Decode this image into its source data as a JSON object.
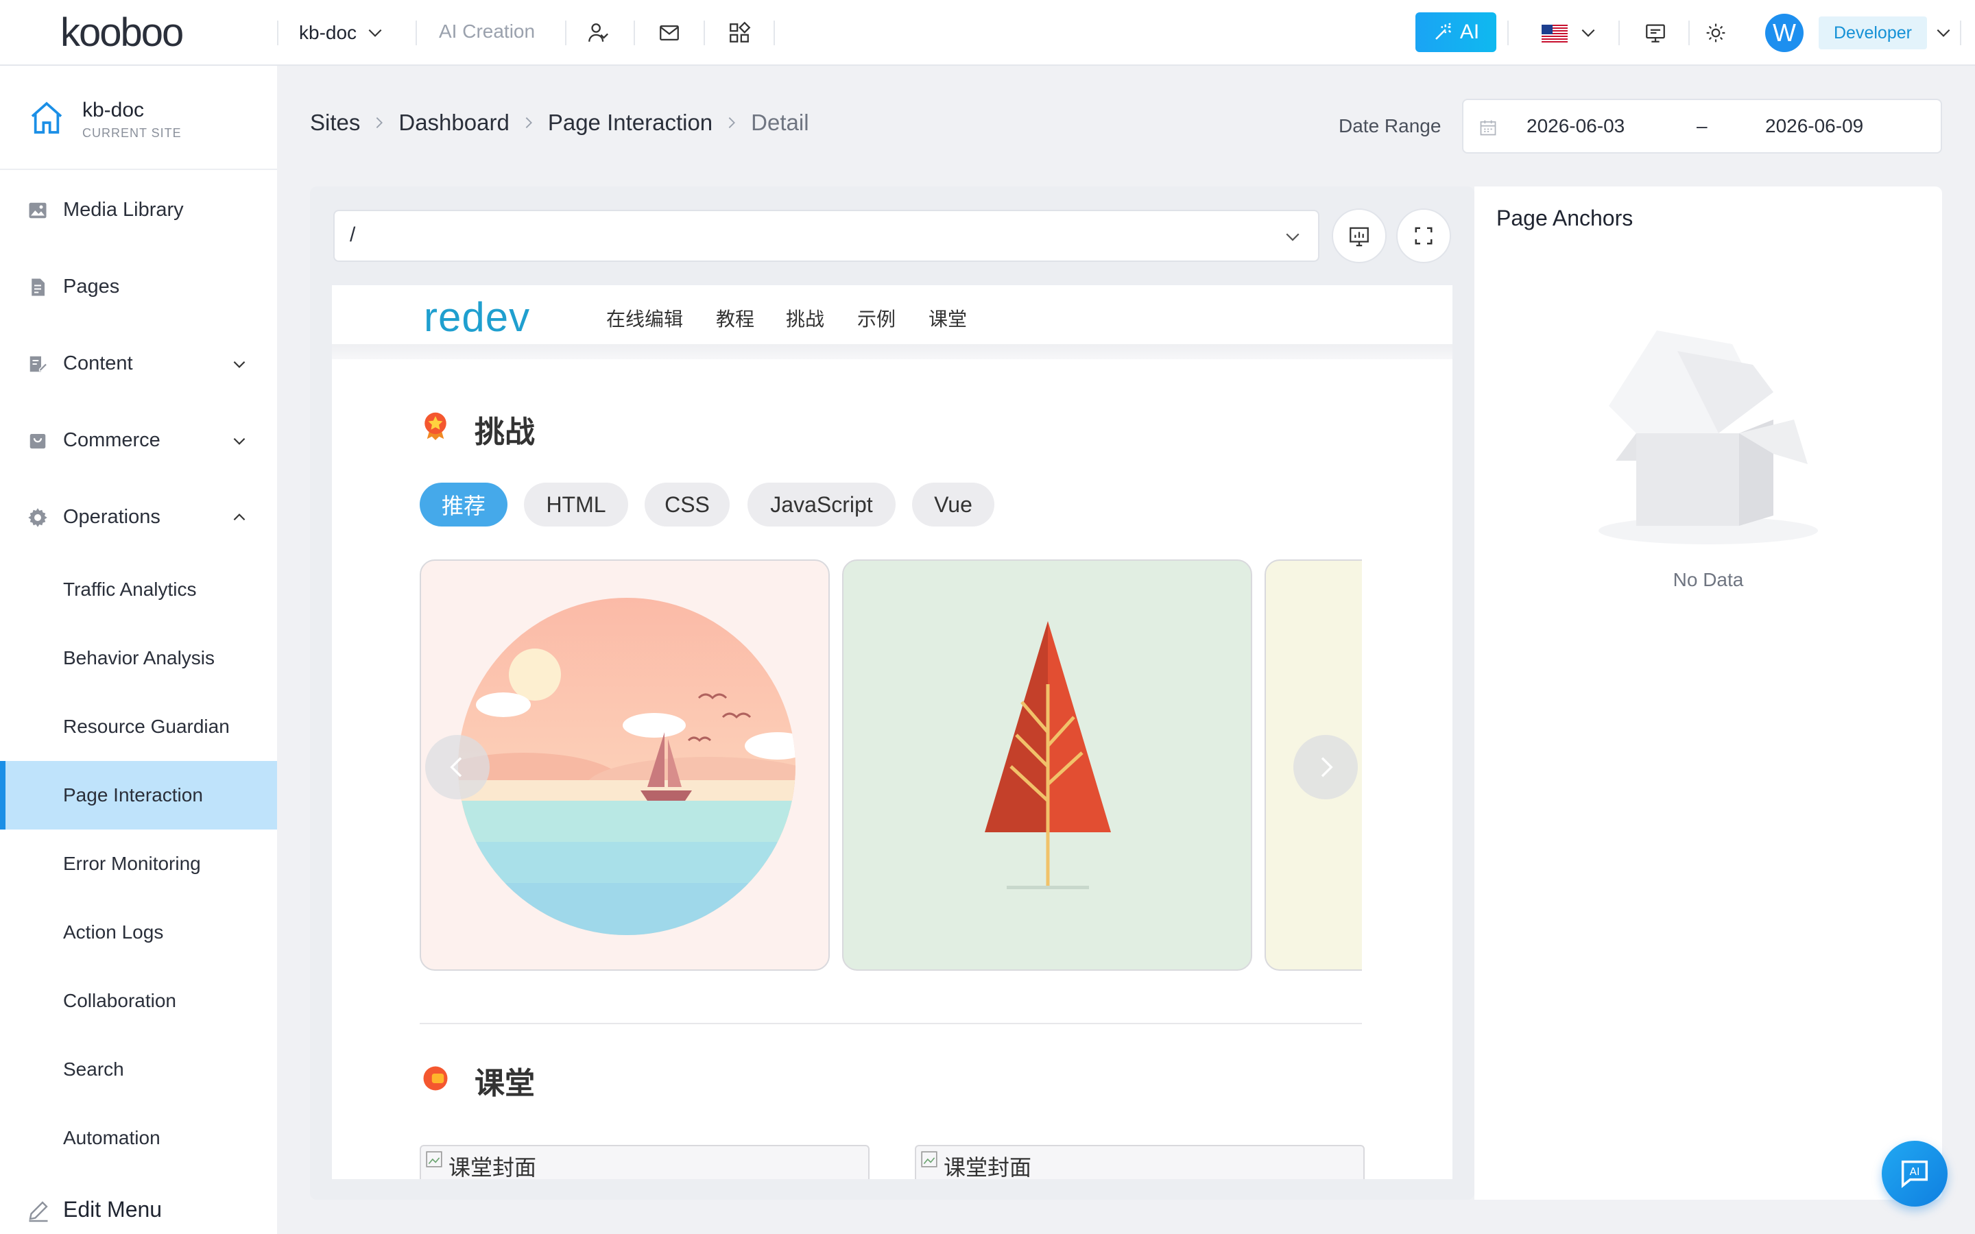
{
  "header": {
    "logo": "kooboo",
    "site": "kb-doc",
    "ai_creation": "AI Creation",
    "ai_button": "AI",
    "avatar_letter": "W",
    "role": "Developer",
    "accent": "#1aa4f4"
  },
  "sidebar": {
    "site_name": "kb-doc",
    "site_sub": "CURRENT SITE",
    "items": [
      {
        "label": "Media Library",
        "icon": "image-icon"
      },
      {
        "label": "Pages",
        "icon": "file-icon"
      },
      {
        "label": "Content",
        "icon": "edit-doc-icon"
      },
      {
        "label": "Commerce",
        "icon": "bag-icon"
      },
      {
        "label": "Operations",
        "icon": "gear-icon"
      }
    ],
    "operations_items": [
      "Traffic Analytics",
      "Behavior Analysis",
      "Resource Guardian",
      "Page Interaction",
      "Error Monitoring",
      "Action Logs",
      "Collaboration",
      "Search",
      "Automation"
    ],
    "active": "Page Interaction",
    "edit_menu": "Edit Menu"
  },
  "breadcrumb": [
    "Sites",
    "Dashboard",
    "Page Interaction",
    "Detail"
  ],
  "date_range": {
    "label": "Date Range",
    "start": "2026-06-03",
    "end": "2026-06-09",
    "separator": "–"
  },
  "url_select": {
    "value": "/"
  },
  "page_anchors": {
    "title": "Page Anchors",
    "empty": "No Data"
  },
  "preview": {
    "logo": "redev",
    "menu": [
      "在线编辑",
      "教程",
      "挑战",
      "示例",
      "课堂"
    ],
    "challenge_title": "挑战",
    "filters": [
      "推荐",
      "HTML",
      "CSS",
      "JavaScript",
      "Vue"
    ],
    "active_filter": "推荐",
    "classroom_title": "课堂",
    "course_alt": "课堂封面"
  }
}
